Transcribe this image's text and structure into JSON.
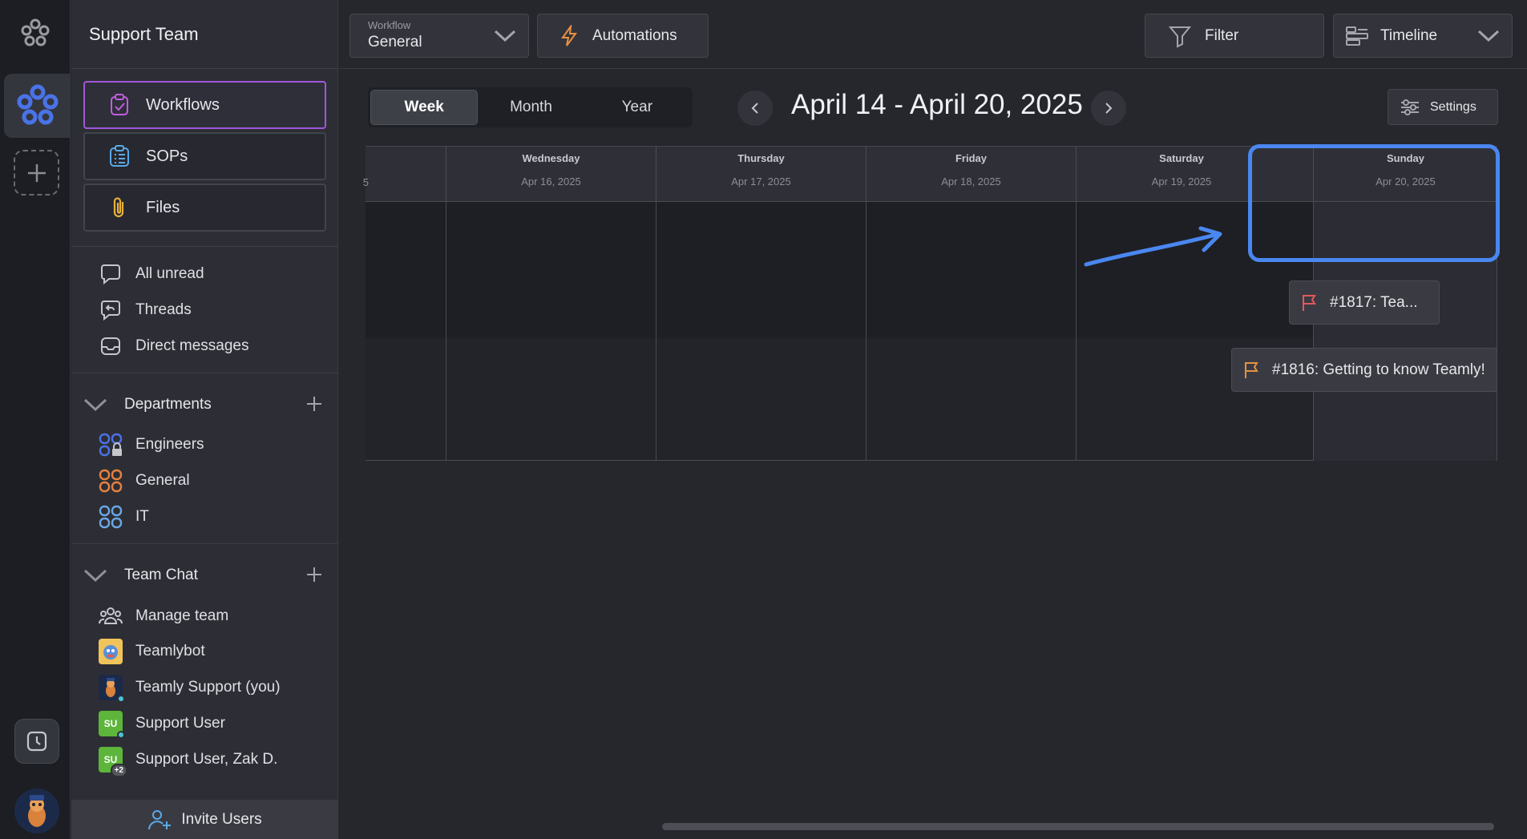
{
  "sidebar": {
    "team_name": "Support Team",
    "nav": [
      {
        "label": "Workflows",
        "icon": "clipboard-check-icon",
        "active": true
      },
      {
        "label": "SOPs",
        "icon": "list-icon"
      },
      {
        "label": "Files",
        "icon": "paperclip-icon"
      }
    ],
    "messages": [
      {
        "label": "All unread",
        "icon": "chat-bubble-icon"
      },
      {
        "label": "Threads",
        "icon": "reply-icon"
      },
      {
        "label": "Direct messages",
        "icon": "inbox-icon"
      }
    ],
    "departments": {
      "title": "Departments",
      "items": [
        {
          "label": "Engineers",
          "color": "#4a73e8"
        },
        {
          "label": "General",
          "color": "#e8813f"
        },
        {
          "label": "IT",
          "color": "#6aa7e6"
        }
      ]
    },
    "team_chat": {
      "title": "Team Chat",
      "items": [
        {
          "label": "Manage team"
        },
        {
          "label": "Teamlybot"
        },
        {
          "label": "Teamly Support (you)"
        },
        {
          "label": "Support User",
          "initials": "SU"
        },
        {
          "label": "Support User, Zak D.",
          "initials": "SU",
          "badge": "+2"
        }
      ]
    },
    "invite_label": "Invite Users"
  },
  "topbar": {
    "workflow_caption": "Workflow",
    "workflow_value": "General",
    "automations_label": "Automations",
    "filter_label": "Filter",
    "view_label": "Timeline"
  },
  "toolbar": {
    "tabs": [
      "Week",
      "Month",
      "Year"
    ],
    "active_tab": "Week",
    "range_title": "April 14 - April 20, 2025",
    "settings_label": "Settings"
  },
  "calendar": {
    "partial_left_date": "5",
    "days": [
      {
        "name": "Wednesday",
        "date": "Apr 16, 2025"
      },
      {
        "name": "Thursday",
        "date": "Apr 17, 2025"
      },
      {
        "name": "Friday",
        "date": "Apr 18, 2025"
      },
      {
        "name": "Saturday",
        "date": "Apr 19, 2025"
      },
      {
        "name": "Sunday",
        "date": "Apr 20, 2025"
      }
    ],
    "events": [
      {
        "label": "#1817: Tea...",
        "flag_color": "#e2595c"
      },
      {
        "label": "#1816: Getting to know Teamly!",
        "flag_color": "#e8913f"
      }
    ]
  },
  "colors": {
    "accent": "#4a87f0",
    "active_border": "#a157d9"
  }
}
